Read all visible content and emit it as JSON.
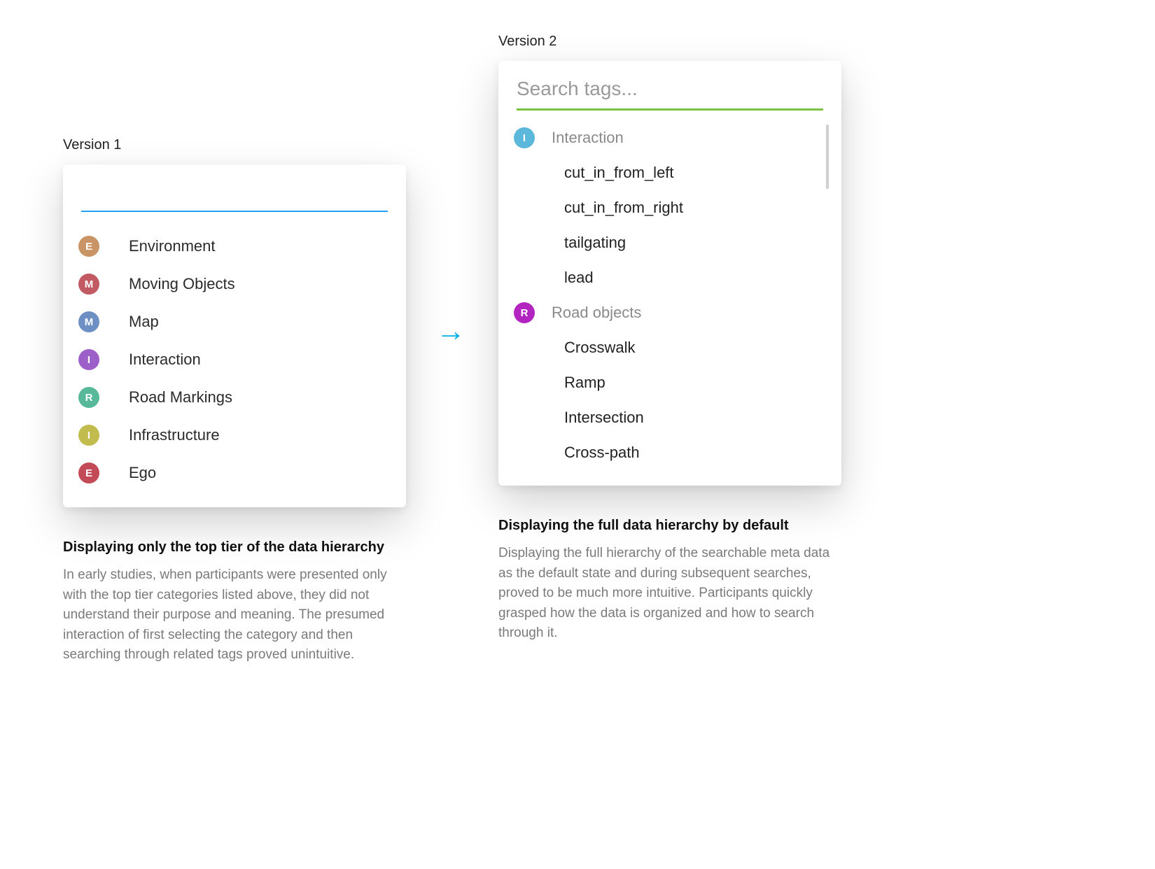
{
  "left": {
    "version_label": "Version 1",
    "underline_color": "#279ff2",
    "categories": [
      {
        "letter": "E",
        "label": "Environment",
        "color": "#c99567"
      },
      {
        "letter": "M",
        "label": "Moving Objects",
        "color": "#c15a63"
      },
      {
        "letter": "M",
        "label": "Map",
        "color": "#6e8fc3"
      },
      {
        "letter": "I",
        "label": "Interaction",
        "color": "#9d60c9"
      },
      {
        "letter": "R",
        "label": "Road Markings",
        "color": "#58b89a"
      },
      {
        "letter": "I",
        "label": "Infrastructure",
        "color": "#c2bb4d"
      },
      {
        "letter": "E",
        "label": "Ego",
        "color": "#c24b57"
      }
    ],
    "caption_title": "Displaying only the top tier of the data hierarchy",
    "caption_body": "In early studies, when participants were presented only with the top tier categories listed above, they did not understand their purpose and meaning. The presumed interaction of first selecting the category and then searching through related tags proved unintuitive."
  },
  "right": {
    "version_label": "Version 2",
    "search_placeholder": "Search tags...",
    "underline_color": "#7AC142",
    "groups": [
      {
        "letter": "I",
        "label": "Interaction",
        "color": "#5bb8db",
        "children": [
          "cut_in_from_left",
          "cut_in_from_right",
          "tailgating",
          "lead"
        ]
      },
      {
        "letter": "R",
        "label": "Road objects",
        "color": "#b225c0",
        "children": [
          "Crosswalk",
          "Ramp",
          "Intersection",
          "Cross-path"
        ]
      }
    ],
    "caption_title": "Displaying the full data hierarchy by default",
    "caption_body": "Displaying the full hierarchy of the searchable meta data as the default state and during subsequent searches, proved to be much more intuitive. Participants quickly grasped how the data is organized and how to search through it."
  },
  "arrow_glyph": "→"
}
